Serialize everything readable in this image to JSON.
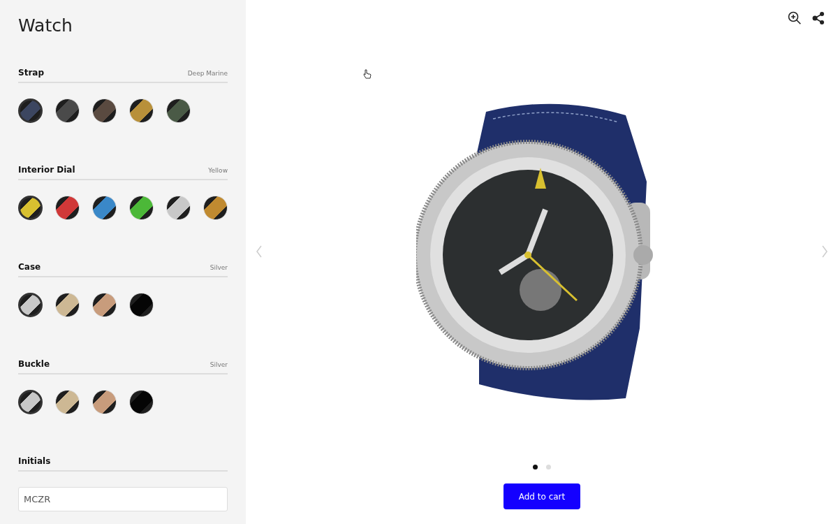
{
  "title": "Watch",
  "sections": [
    {
      "label": "Strap",
      "value": "Deep Marine",
      "swatches": [
        {
          "color": "#3c4660",
          "selected": true
        },
        {
          "color": "#4a4a4a",
          "selected": false
        },
        {
          "color": "#5a4a40",
          "selected": false
        },
        {
          "color": "#b8903a",
          "selected": false
        },
        {
          "color": "#4a5a46",
          "selected": false
        }
      ]
    },
    {
      "label": "Interior Dial",
      "value": "Yellow",
      "swatches": [
        {
          "color": "#d8c030",
          "selected": true
        },
        {
          "color": "#d03838",
          "selected": false
        },
        {
          "color": "#3a88c8",
          "selected": false
        },
        {
          "color": "#4cb838",
          "selected": false
        },
        {
          "color": "#c8c8c8",
          "selected": false
        },
        {
          "color": "#c08a30",
          "selected": false
        }
      ]
    },
    {
      "label": "Case",
      "value": "Silver",
      "swatches": [
        {
          "color": "#c8c8c8",
          "selected": true
        },
        {
          "color": "#cdb894",
          "selected": false
        },
        {
          "color": "#c89c7c",
          "selected": false
        },
        {
          "color": "#050505",
          "selected": false
        }
      ]
    },
    {
      "label": "Buckle",
      "value": "Silver",
      "swatches": [
        {
          "color": "#c8c8c8",
          "selected": true
        },
        {
          "color": "#cdb894",
          "selected": false
        },
        {
          "color": "#c89c7c",
          "selected": false
        },
        {
          "color": "#050505",
          "selected": false
        }
      ]
    }
  ],
  "initials": {
    "label": "Initials",
    "value": "MCZR"
  },
  "pager": [
    {
      "selected": true
    },
    {
      "selected": false
    }
  ],
  "cart_button": "Add to cart"
}
